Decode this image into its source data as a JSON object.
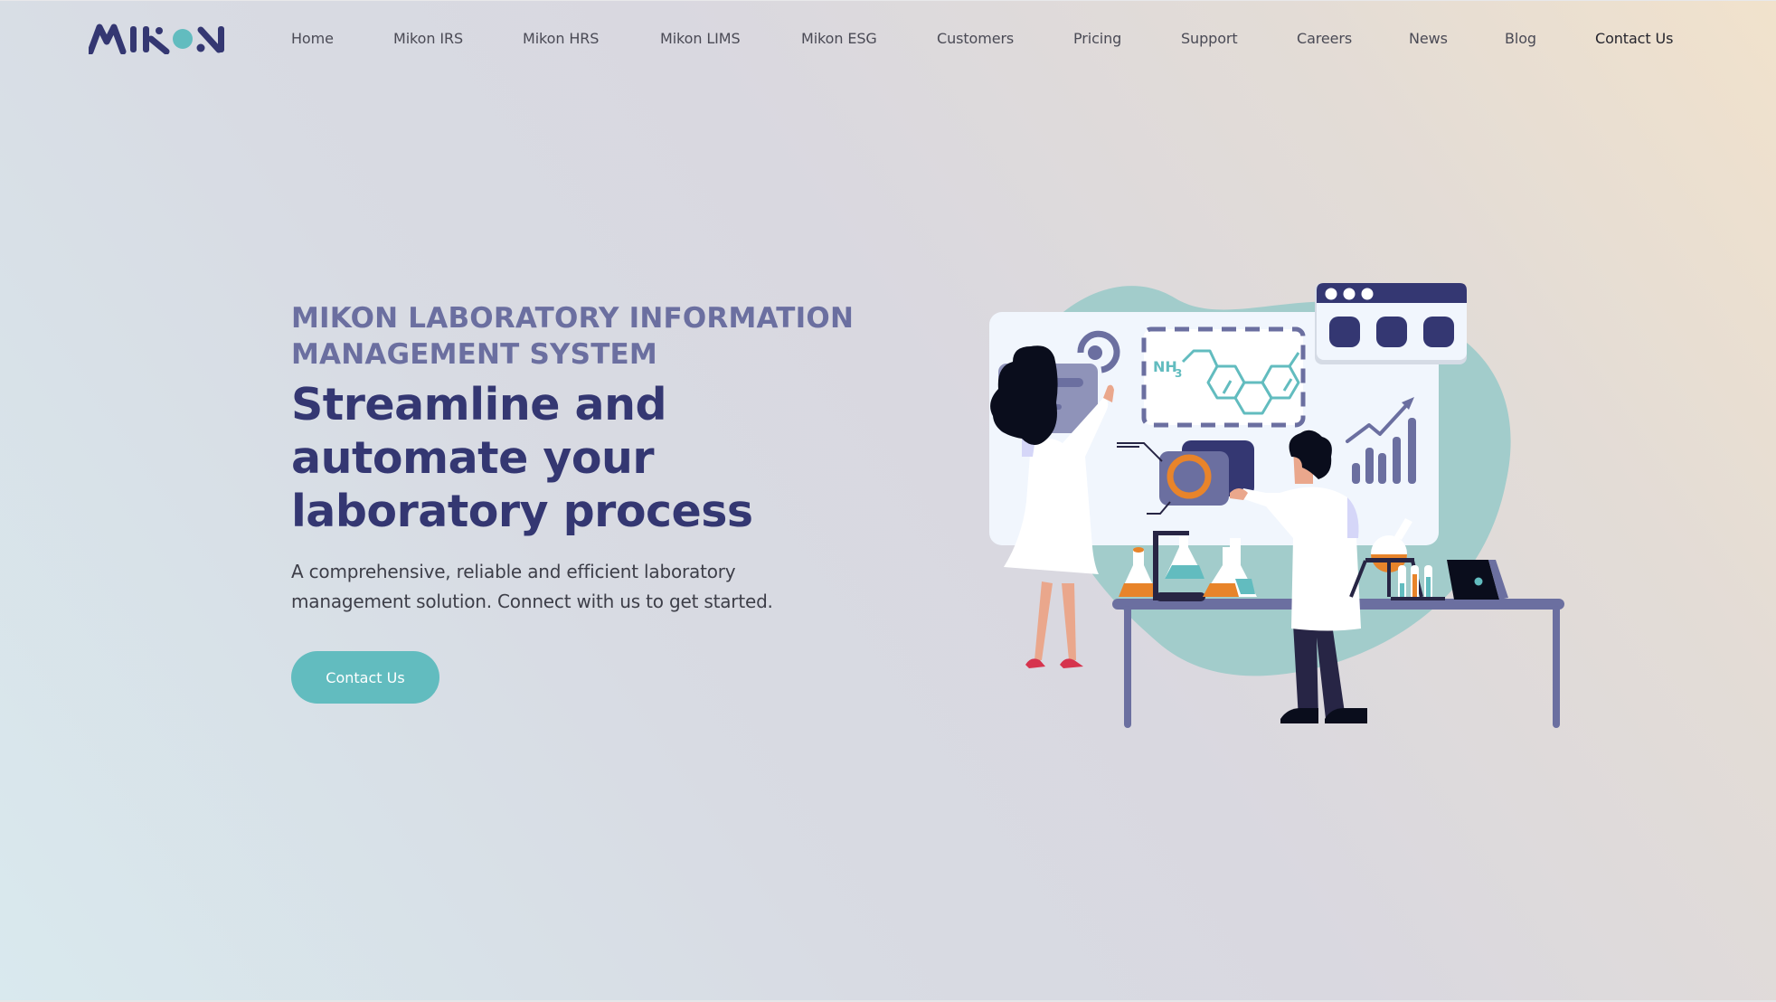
{
  "brand": {
    "name": "MIKON",
    "logo_icon": "mikon-wordmark-logo",
    "colors": {
      "primary": "#343772",
      "accent": "#62bcbf",
      "muted": "#6b6fa0"
    }
  },
  "nav": {
    "items": [
      {
        "label": "Home"
      },
      {
        "label": "Mikon IRS"
      },
      {
        "label": "Mikon HRS"
      },
      {
        "label": "Mikon LIMS"
      },
      {
        "label": "Mikon ESG"
      },
      {
        "label": "Customers"
      },
      {
        "label": "Pricing"
      },
      {
        "label": "Support"
      },
      {
        "label": "Careers"
      },
      {
        "label": "News"
      },
      {
        "label": "Blog"
      },
      {
        "label": "Contact Us"
      }
    ]
  },
  "hero": {
    "eyebrow": "MIKON LABORATORY INFORMATION MANAGEMENT SYSTEM",
    "headline": "Streamline and automate your laboratory process",
    "lead": "A comprehensive, reliable and efficient laboratory management solution. Connect with us to get started.",
    "cta_label": "Contact Us",
    "illustration": {
      "description": "two-scientists-at-lab-bench-illustration",
      "formula_label": "NH",
      "formula_subscript": "3"
    }
  }
}
